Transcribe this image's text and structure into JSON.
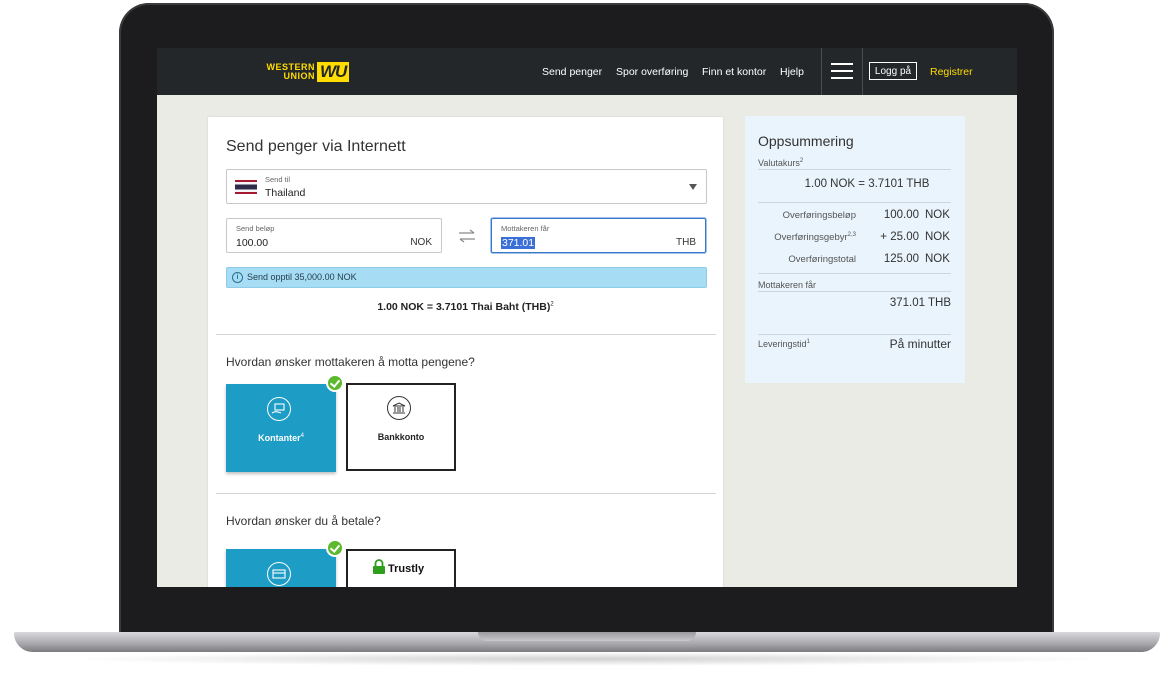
{
  "nav": {
    "logo_line1": "WESTERN",
    "logo_line2": "UNION",
    "logo_mark": "WU",
    "links": [
      "Send penger",
      "Spor overføring",
      "Finn et kontor",
      "Hjelp"
    ],
    "login": "Logg på",
    "register": "Registrer"
  },
  "form": {
    "title": "Send penger via Internett",
    "send_to_label": "Send til",
    "send_to_value": "Thailand",
    "send_amount_label": "Send beløp",
    "send_amount_value": "100.00",
    "send_currency": "NOK",
    "receiver_gets_label": "Mottakeren får",
    "receiver_gets_value": "371.01",
    "receiver_currency": "THB",
    "info_text": "Send opptil 35,000.00 NOK",
    "rate_text": "1.00 NOK = 3.7101 Thai Baht (THB)",
    "rate_sup": "2",
    "receive_question": "Hvordan ønsker mottakeren å motta pengene?",
    "receive_options": [
      {
        "label": "Kontanter",
        "sup": "4",
        "selected": true
      },
      {
        "label": "Bankkonto",
        "selected": false
      }
    ],
    "pay_question": "Hvordan ønsker du å betale?",
    "pay_options": [
      {
        "label": "",
        "selected": true
      },
      {
        "label": "Trustly",
        "selected": false
      }
    ]
  },
  "summary": {
    "title": "Oppsummering",
    "rate_label": "Valutakurs",
    "rate_label_sup": "2",
    "rate_value": "1.00 NOK = 3.7101 THB",
    "transfer_amount_label": "Overføringsbeløp",
    "transfer_amount_value": "100.00",
    "transfer_fee_label": "Overføringsgebyr",
    "transfer_fee_sup": "2,3",
    "transfer_fee_value": "+ 25.00",
    "transfer_total_label": "Overføringstotal",
    "transfer_total_value": "125.00",
    "currency": "NOK",
    "receiver_gets_label": "Mottakeren får",
    "receiver_gets_value": "371.01 THB",
    "delivery_label": "Leveringstid",
    "delivery_sup": "1",
    "delivery_value": "På minutter"
  },
  "colors": {
    "nav_bg": "#24272a",
    "brand_yellow": "#ffdd00",
    "selected_option": "#1d9cc5",
    "info_bar": "#a6dcf4",
    "check_green": "#5cb82c",
    "summary_bg": "#e9f4fc"
  },
  "icons": {
    "cash": "cash-hand-icon",
    "bank": "bank-building-icon",
    "card": "credit-card-icon",
    "trustly": "trustly-lock-icon",
    "swap": "swap-arrows-icon",
    "info": "info-icon",
    "menu": "hamburger-menu-icon",
    "check": "check-circle-icon"
  }
}
